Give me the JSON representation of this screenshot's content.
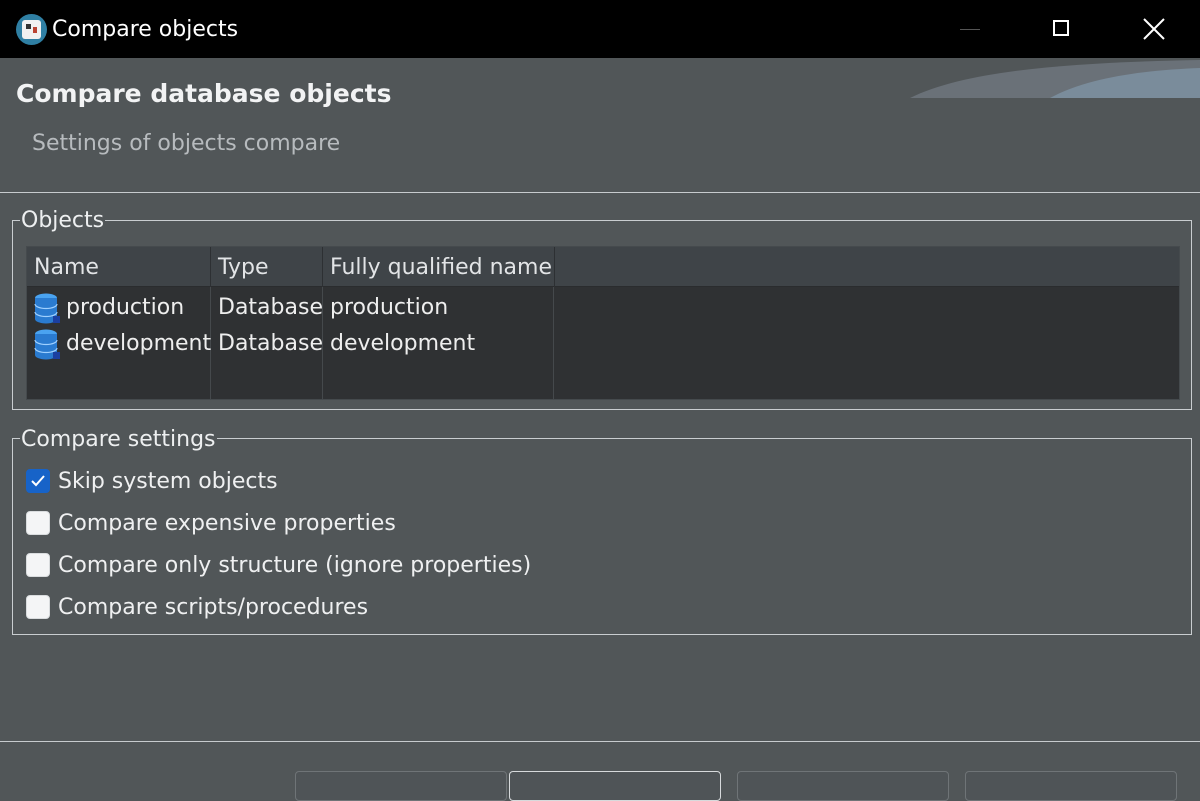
{
  "window": {
    "title": "Compare objects"
  },
  "dialog": {
    "title": "Compare database objects",
    "subtitle": "Settings of objects compare"
  },
  "objects": {
    "legend": "Objects",
    "columns": [
      "Name",
      "Type",
      "Fully qualified name"
    ],
    "rows": [
      {
        "name": "production",
        "type": "Database",
        "fqn": "production",
        "icon": "database-icon"
      },
      {
        "name": "development",
        "type": "Database",
        "fqn": "development",
        "icon": "database-icon"
      }
    ]
  },
  "settings": {
    "legend": "Compare settings",
    "options": [
      {
        "label": "Skip system objects",
        "checked": true
      },
      {
        "label": "Compare expensive properties",
        "checked": false
      },
      {
        "label": "Compare only structure (ignore properties)",
        "checked": false
      },
      {
        "label": "Compare scripts/procedures",
        "checked": false
      }
    ]
  },
  "colors": {
    "background": "#515658",
    "titlebar": "#000000",
    "checkbox_accent": "#1763c8",
    "table_background": "#2f3133"
  }
}
